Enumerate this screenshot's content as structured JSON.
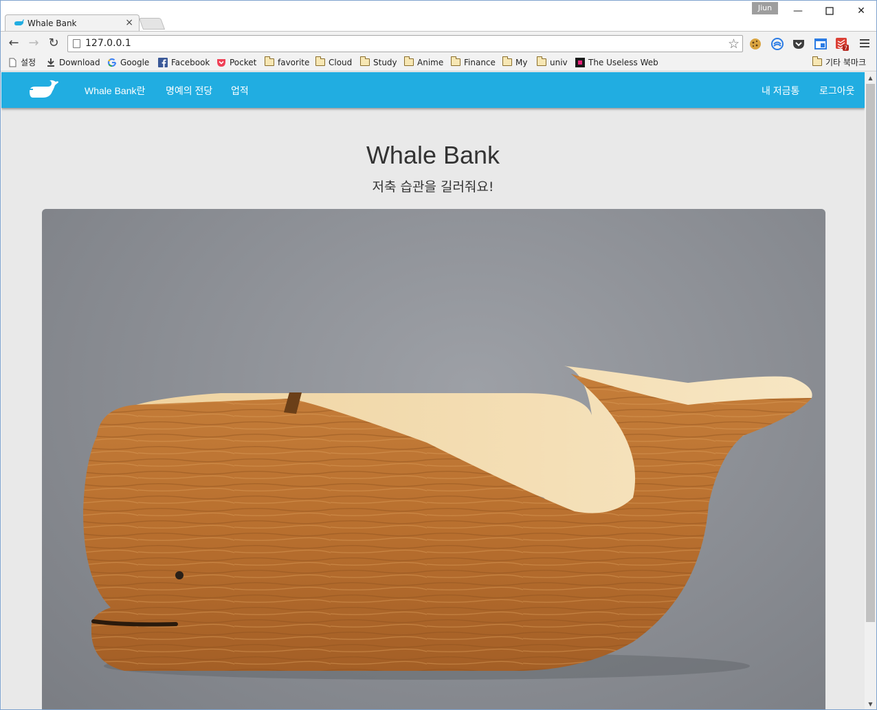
{
  "browser": {
    "tab_title": "Whale Bank",
    "profile_name": "Jiun",
    "url": "127.0.0.1",
    "bookmarks": [
      {
        "label": "설정",
        "icon": "page-icon"
      },
      {
        "label": "Download",
        "icon": "download-icon"
      },
      {
        "label": "Google",
        "icon": "google-icon"
      },
      {
        "label": "Facebook",
        "icon": "facebook-icon"
      },
      {
        "label": "Pocket",
        "icon": "pocket-icon"
      },
      {
        "label": "favorite",
        "icon": "folder-icon"
      },
      {
        "label": "Cloud",
        "icon": "folder-icon"
      },
      {
        "label": "Study",
        "icon": "folder-icon"
      },
      {
        "label": "Anime",
        "icon": "folder-icon"
      },
      {
        "label": "Finance",
        "icon": "folder-icon"
      },
      {
        "label": "My",
        "icon": "folder-icon"
      },
      {
        "label": "univ",
        "icon": "folder-icon"
      },
      {
        "label": "The Useless Web",
        "icon": "useless-web-icon"
      }
    ],
    "other_bookmarks": "기타 북마크",
    "extension_badge": "7"
  },
  "site": {
    "nav": {
      "about": "Whale Bank란",
      "hall_of_fame": "명예의 전당",
      "achievements": "업적",
      "my_piggybank": "내 저금통",
      "logout": "로그아웃"
    },
    "hero": {
      "title": "Whale Bank",
      "subtitle": "저축 습관을 길러줘요!"
    },
    "colors": {
      "navbar": "#21ade1",
      "background": "#e9e9e9"
    }
  }
}
